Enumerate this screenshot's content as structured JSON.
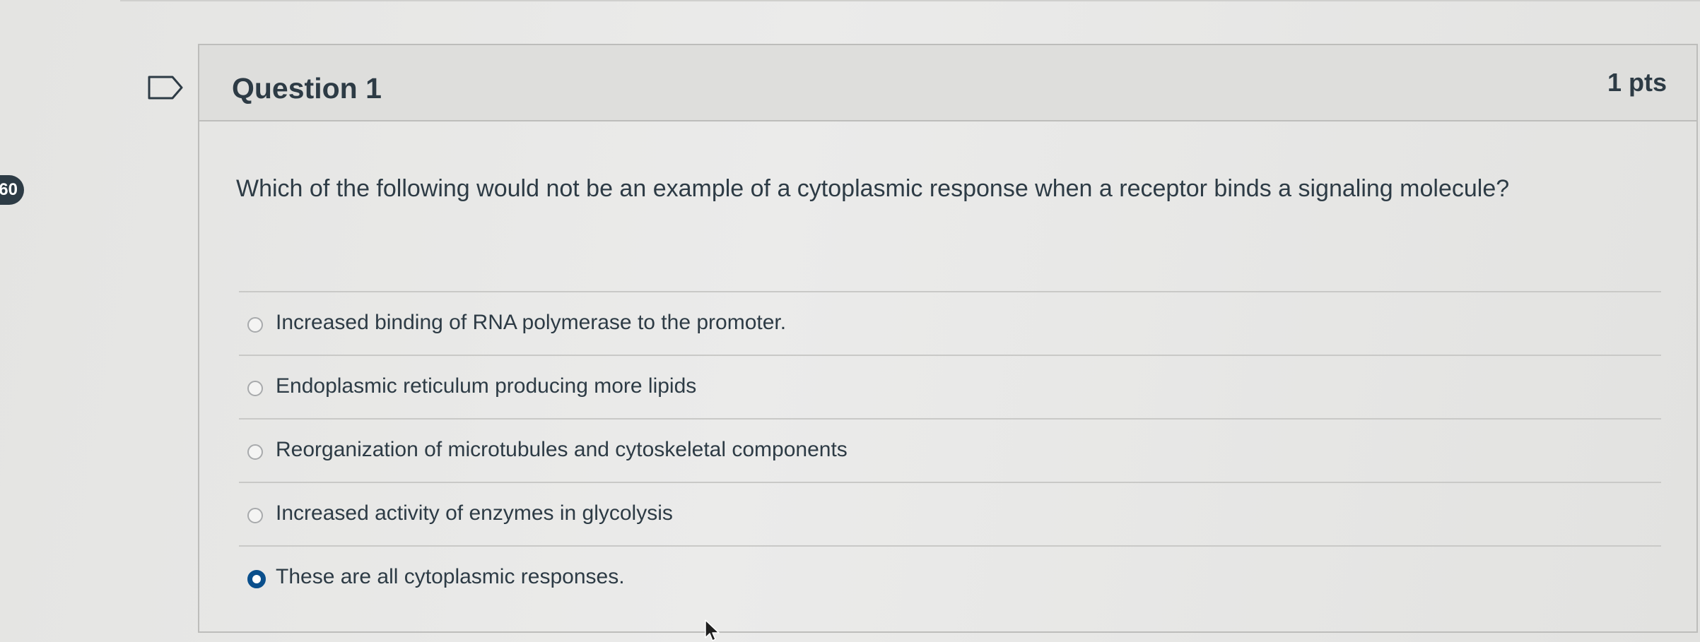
{
  "sidebar": {
    "badge_text": "60"
  },
  "question": {
    "title": "Question 1",
    "points": "1 pts",
    "text": "Which of the following would not be an example of a cytoplasmic response when a receptor binds a signaling molecule?",
    "flag_icon": "flag-icon"
  },
  "answers": [
    {
      "label": "Increased binding of RNA polymerase to the promoter.",
      "selected": false
    },
    {
      "label": "Endoplasmic reticulum producing more lipids",
      "selected": false
    },
    {
      "label": "Reorganization of microtubules and cytoskeletal components",
      "selected": false
    },
    {
      "label": "Increased activity of enzymes in glycolysis",
      "selected": false
    },
    {
      "label": "These are all cytoplasmic responses.",
      "selected": true
    }
  ],
  "colors": {
    "text": "#2d3b45",
    "selected_radio": "#0a4f8c",
    "header_bg": "#dededc"
  }
}
